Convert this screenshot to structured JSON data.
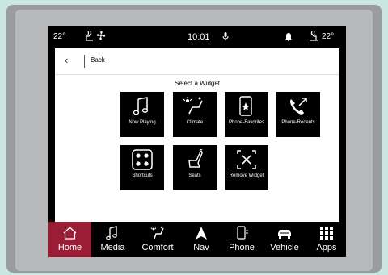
{
  "statusbar": {
    "temp_left": "22°",
    "clock": "10:01",
    "temp_right": "22°"
  },
  "header": {
    "back_label": "Back",
    "section_title": "Select a Widget"
  },
  "widgets": [
    {
      "label": "Now Playing",
      "icon": "music-note-icon"
    },
    {
      "label": "Climate",
      "icon": "climate-icon"
    },
    {
      "label": "Phone-Favorites",
      "icon": "phone-favorites-icon"
    },
    {
      "label": "Phone-Recents",
      "icon": "phone-recents-icon"
    },
    {
      "label": "Shortcuts",
      "icon": "shortcuts-icon"
    },
    {
      "label": "Seats",
      "icon": "seat-icon"
    },
    {
      "label": "Remove Widget",
      "icon": "remove-widget-icon"
    }
  ],
  "nav": {
    "items": [
      {
        "label": "Home",
        "icon": "home-icon",
        "active": true
      },
      {
        "label": "Media",
        "icon": "music-note-icon"
      },
      {
        "label": "Comfort",
        "icon": "comfort-icon"
      },
      {
        "label": "Nav",
        "icon": "navigation-arrow-icon"
      },
      {
        "label": "Phone",
        "icon": "phone-icon"
      },
      {
        "label": "Vehicle",
        "icon": "car-icon"
      },
      {
        "label": "Apps",
        "icon": "apps-grid-icon"
      }
    ]
  },
  "colors": {
    "active_nav": "#9a1c35",
    "tile_bg": "#000000",
    "content_bg": "#ffffff",
    "bezel": "#9a9c9e",
    "background": "#c9e6e0"
  }
}
